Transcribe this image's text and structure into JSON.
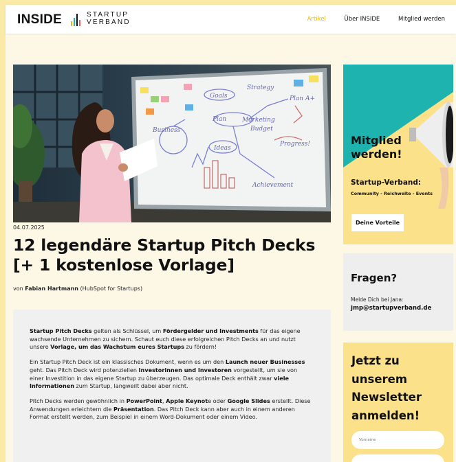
{
  "header": {
    "logo_main": "INSIDE",
    "logo_line1": "STARTUP",
    "logo_line2": "VERBAND",
    "nav": [
      "Artikel",
      "Über INSIDE",
      "Mitglied werden"
    ],
    "active_nav": "Artikel",
    "accent_color": "#f0b800"
  },
  "article": {
    "date": "04.07.2025",
    "title": "12 legendäre Startup Pitch Decks [+ 1 kostenlose Vorlage]",
    "byline_prefix": "von ",
    "author": "Fabian Hartmann",
    "author_org": " (HubSpot for Startups)",
    "paragraphs": [
      [
        {
          "t": "Startup Pitch Decks",
          "b": true
        },
        {
          "t": " gelten als Schlüssel, um ",
          "b": false
        },
        {
          "t": "Fördergelder und Investments",
          "b": true
        },
        {
          "t": " für das eigene wachsende Unternehmen zu sichern. Schaut euch diese erfolgreichen Pitch Decks an und nutzt unsere ",
          "b": false
        },
        {
          "t": "Vorlage, um das Wachstum eures Startups",
          "b": true
        },
        {
          "t": " zu fördern!",
          "b": false
        }
      ],
      [
        {
          "t": "Ein Startup Pitch Deck ist ein klassisches Dokument, wenn es um den ",
          "b": false
        },
        {
          "t": "Launch neuer Businesses",
          "b": true
        },
        {
          "t": " geht. Das Pitch Deck wird potenziellen ",
          "b": false
        },
        {
          "t": "Investorinnen und Investoren",
          "b": true
        },
        {
          "t": " vorgestellt, um sie von einer Investition in das eigene Startup zu überzeugen. Das optimale Deck enthält zwar ",
          "b": false
        },
        {
          "t": "viele Informationen",
          "b": true
        },
        {
          "t": " zum Startup, langweilt dabei aber nicht.",
          "b": false
        }
      ],
      [
        {
          "t": "Pitch Decks werden gewöhnlich in ",
          "b": false
        },
        {
          "t": "PowerPoint",
          "b": true
        },
        {
          "t": ", ",
          "b": false
        },
        {
          "t": "Apple Keynot",
          "b": true
        },
        {
          "t": "e oder ",
          "b": false
        },
        {
          "t": "Google Slides",
          "b": true
        },
        {
          "t": " erstellt. Diese Anwendungen erleichtern die ",
          "b": false
        },
        {
          "t": "Präsentation",
          "b": true
        },
        {
          "t": ". Das Pitch Deck kann aber auch in einem anderen Format erstellt werden, zum Beispiel in einem Word-Dokument oder einem Video.",
          "b": false
        }
      ]
    ]
  },
  "hero_image": {
    "whiteboard_words": [
      "Strategy",
      "Plan A+",
      "Marketing",
      "Budget",
      "Progress!",
      "Goals",
      "Achievement",
      "Plan",
      "Ideas",
      "Business"
    ]
  },
  "sidebar": {
    "member": {
      "title": "Mitglied werden!",
      "subtitle": "Startup-Verband:",
      "tags": "Community - Reichweite - Events",
      "button": "Deine Vorteile"
    },
    "questions": {
      "title": "Fragen?",
      "text": "Melde Dich bei Jana:",
      "email": "jmp@startupverband.de"
    },
    "newsletter": {
      "title": "Jetzt zu unserem Newsletter anmelden!",
      "firstname_placeholder": "Vorname",
      "lastname_placeholder": ""
    }
  },
  "colors": {
    "page_bg": "#fdf8e6",
    "yellow": "#fbe28a",
    "teal": "#1fb3b0",
    "grey_box": "#eeeeee"
  }
}
